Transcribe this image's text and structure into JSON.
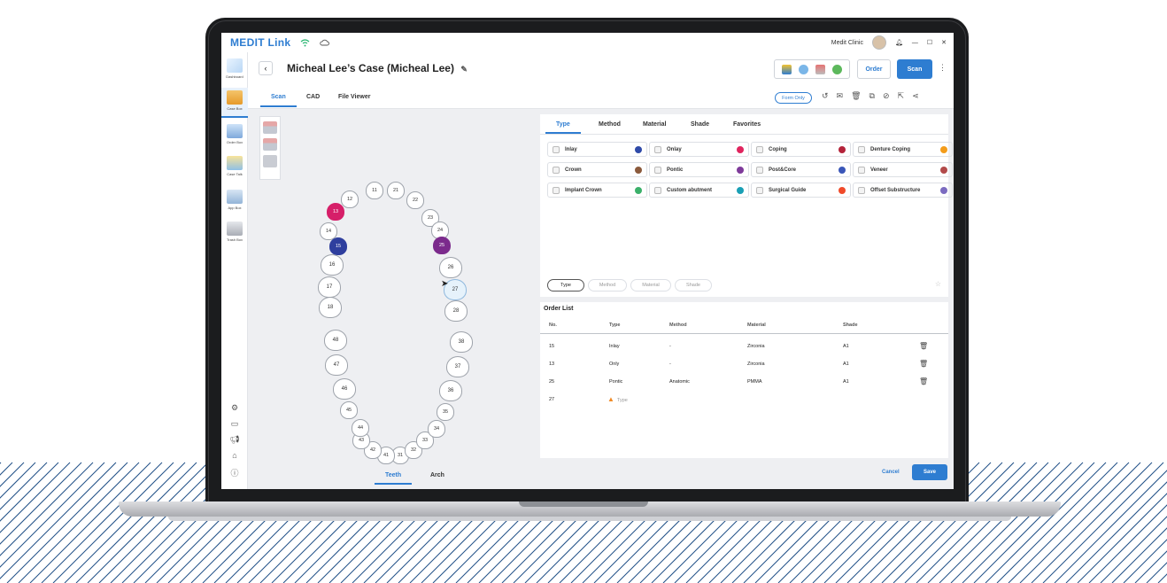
{
  "app": {
    "logo": "MEDIT Link",
    "clinic": "Medit Clinic",
    "case_title": "Micheal Lee’s Case (Micheal Lee)"
  },
  "sidebar": {
    "items": [
      {
        "label": "Dashboard"
      },
      {
        "label": "Case Box"
      },
      {
        "label": "Order Box"
      },
      {
        "label": "Case Talk"
      },
      {
        "label": "App Box"
      },
      {
        "label": "Trash Box"
      }
    ]
  },
  "header": {
    "order_label": "Order",
    "scan_label": "Scan"
  },
  "tabs": [
    "Scan",
    "CAD",
    "File Viewer"
  ],
  "form_only_label": "Form Only",
  "teeth": {
    "upper": [
      "11",
      "12",
      "13",
      "14",
      "15",
      "16",
      "17",
      "18",
      "21",
      "22",
      "23",
      "24",
      "25",
      "26",
      "27",
      "28"
    ],
    "lower": [
      "31",
      "32",
      "33",
      "34",
      "35",
      "36",
      "37",
      "38",
      "41",
      "42",
      "43",
      "44",
      "45",
      "46",
      "47",
      "48"
    ],
    "selected": {
      "13": "#d61f69",
      "15": "#2f3f9e",
      "25": "#7b2a8c",
      "27": "#e6f2fb"
    },
    "bottom_tabs": [
      "Teeth",
      "Arch"
    ]
  },
  "type_panel": {
    "tabs": [
      "Type",
      "Method",
      "Material",
      "Shade",
      "Favorites"
    ],
    "options": [
      {
        "label": "Inlay",
        "color": "#2f4aa8"
      },
      {
        "label": "Onlay",
        "color": "#e0245e"
      },
      {
        "label": "Coping",
        "color": "#b4233a"
      },
      {
        "label": "Denture Coping",
        "color": "#f39c1b"
      },
      {
        "label": "Crown",
        "color": "#8b5a3c"
      },
      {
        "label": "Pontic",
        "color": "#7e3a9a"
      },
      {
        "label": "Post&Core",
        "color": "#3a56b8"
      },
      {
        "label": "Veneer",
        "color": "#b24a4a"
      },
      {
        "label": "Implant Crown",
        "color": "#3bb06a"
      },
      {
        "label": "Custom abutment",
        "color": "#1a9fb5"
      },
      {
        "label": "Surgical Guide",
        "color": "#f04a2a"
      },
      {
        "label": "Offset Substructure",
        "color": "#7b6bc0"
      }
    ],
    "filter_pills": [
      "Type",
      "Method",
      "Material",
      "Shade"
    ]
  },
  "order_list": {
    "title": "Order List",
    "columns": [
      "No.",
      "Type",
      "Method",
      "Material",
      "Shade"
    ],
    "rows": [
      {
        "no": "15",
        "type": "Inlay",
        "method": "-",
        "material": "Zirconia",
        "shade": "A1"
      },
      {
        "no": "13",
        "type": "Only",
        "method": "-",
        "material": "Zirconia",
        "shade": "A1"
      },
      {
        "no": "25",
        "type": "Pontic",
        "method": "Anatomic",
        "material": "PMMA",
        "shade": "A1"
      },
      {
        "no": "27",
        "type": "Type",
        "method": "",
        "material": "",
        "shade": ""
      }
    ]
  },
  "footer": {
    "cancel_label": "Cancel",
    "save_label": "Save"
  }
}
